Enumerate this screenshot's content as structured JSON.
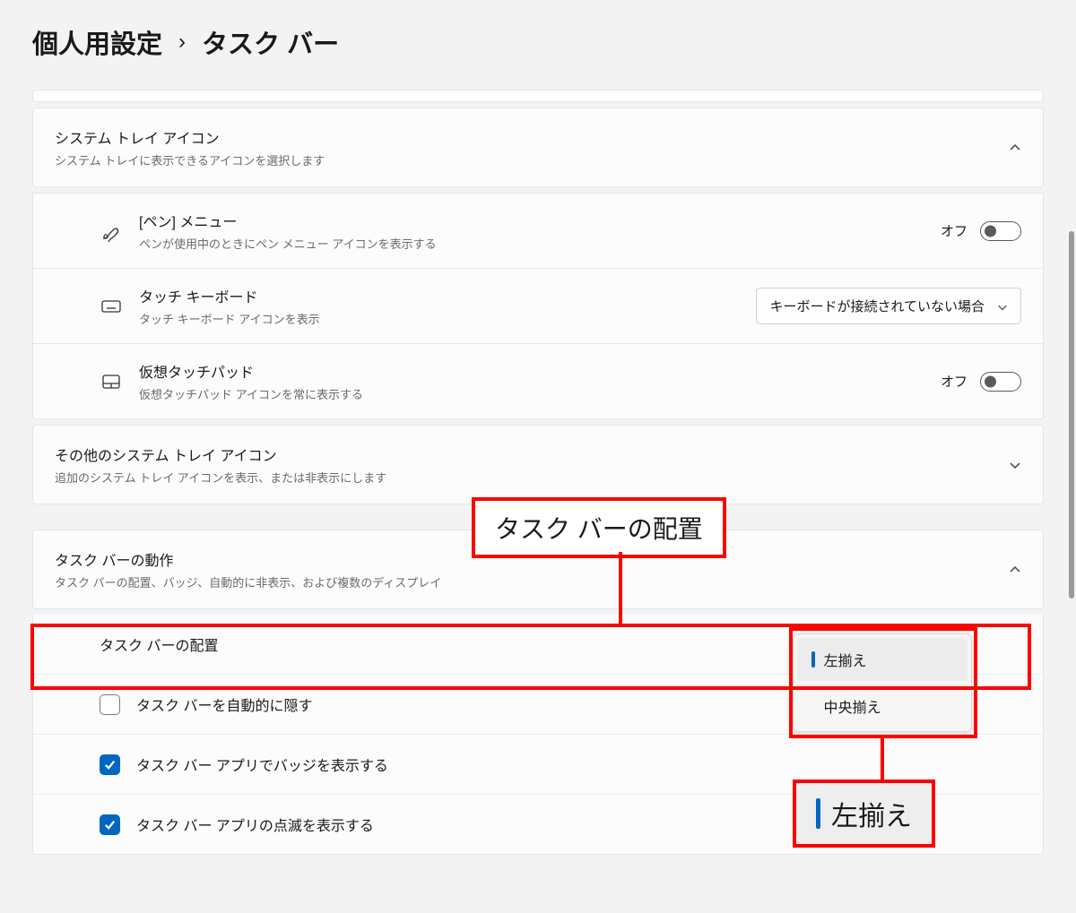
{
  "breadcrumb": {
    "parent": "個人用設定",
    "sep": "›",
    "current": "タスク バー"
  },
  "tray": {
    "title": "システム トレイ アイコン",
    "sub": "システム トレイに表示できるアイコンを選択します",
    "pen": {
      "title": "[ペン] メニュー",
      "sub": "ペンが使用中のときにペン メニュー アイコンを表示する",
      "state": "オフ"
    },
    "touchkb": {
      "title": "タッチ キーボード",
      "sub": "タッチ キーボード アイコンを表示",
      "dropdown": "キーボードが接続されていない場合"
    },
    "vtouch": {
      "title": "仮想タッチパッド",
      "sub": "仮想タッチパッド アイコンを常に表示する",
      "state": "オフ"
    }
  },
  "other": {
    "title": "その他のシステム トレイ アイコン",
    "sub": "追加のシステム トレイ アイコンを表示、または非表示にします"
  },
  "behavior": {
    "title": "タスク バーの動作",
    "sub": "タスク バーの配置、バッジ、自動的に非表示、および複数のディスプレイ",
    "align_label": "タスク バーの配置",
    "auto_hide": "タスク バーを自動的に隠す",
    "badges": "タスク バー アプリでバッジを表示する",
    "flash": "タスク バー アプリの点滅を表示する"
  },
  "align_popup": {
    "opt1": "左揃え",
    "opt2": "中央揃え"
  },
  "annotation": {
    "callout_title": "タスク バーの配置",
    "selected": "左揃え"
  }
}
